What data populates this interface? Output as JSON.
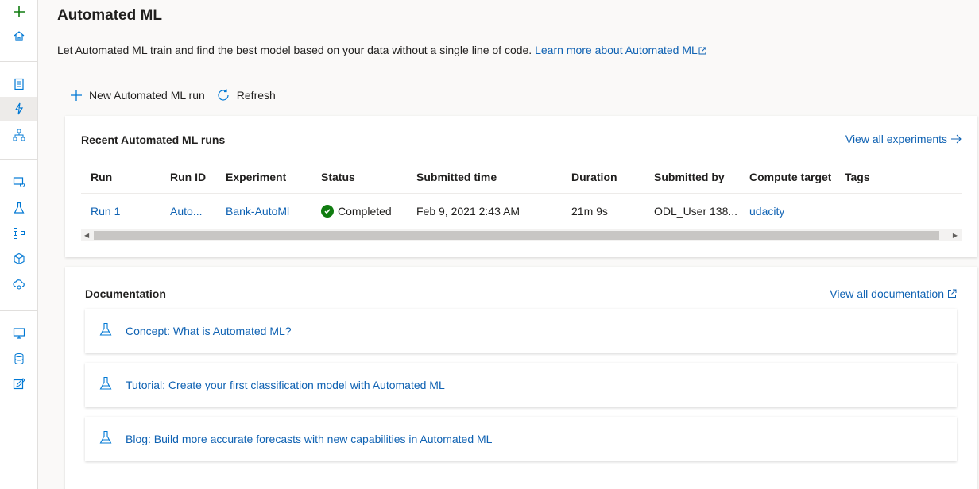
{
  "rail": {
    "items": [
      {
        "icon": "plus-icon"
      },
      {
        "icon": "home-icon"
      },
      {
        "icon": "notebook-icon"
      },
      {
        "icon": "automated-ml-icon",
        "active": true
      },
      {
        "icon": "designer-icon"
      },
      {
        "icon": "datasets-icon"
      },
      {
        "icon": "experiments-icon"
      },
      {
        "icon": "pipelines-icon"
      },
      {
        "icon": "models-icon"
      },
      {
        "icon": "endpoints-icon"
      },
      {
        "icon": "compute-icon"
      },
      {
        "icon": "datastores-icon"
      },
      {
        "icon": "data-labeling-icon"
      }
    ]
  },
  "page": {
    "title": "Automated ML",
    "description": "Let Automated ML train and find the best model based on your data without a single line of code.",
    "learn_more": "Learn more about Automated ML"
  },
  "toolbar": {
    "new_run_label": "New Automated ML run",
    "refresh_label": "Refresh"
  },
  "runs_card": {
    "title": "Recent Automated ML runs",
    "view_all_label": "View all experiments",
    "columns": [
      "Run",
      "Run ID",
      "Experiment",
      "Status",
      "Submitted time",
      "Duration",
      "Submitted by",
      "Compute target",
      "Tags"
    ],
    "rows": [
      {
        "run": "Run 1",
        "run_id": "Auto...",
        "experiment": "Bank-AutoMl",
        "status": "Completed",
        "submitted_time": "Feb 9, 2021 2:43 AM",
        "duration": "21m 9s",
        "submitted_by": "ODL_User 138...",
        "compute_target": "udacity",
        "tags": ""
      }
    ]
  },
  "docs_card": {
    "title": "Documentation",
    "view_all_label": "View all documentation",
    "items": [
      {
        "label": "Concept: What is Automated ML?"
      },
      {
        "label": "Tutorial: Create your first classification model with Automated ML"
      },
      {
        "label": "Blog: Build more accurate forecasts with new capabilities in Automated ML"
      }
    ]
  },
  "colors": {
    "accent": "#0f62b3",
    "rail_icon": "#0078d4",
    "success": "#107c10"
  }
}
